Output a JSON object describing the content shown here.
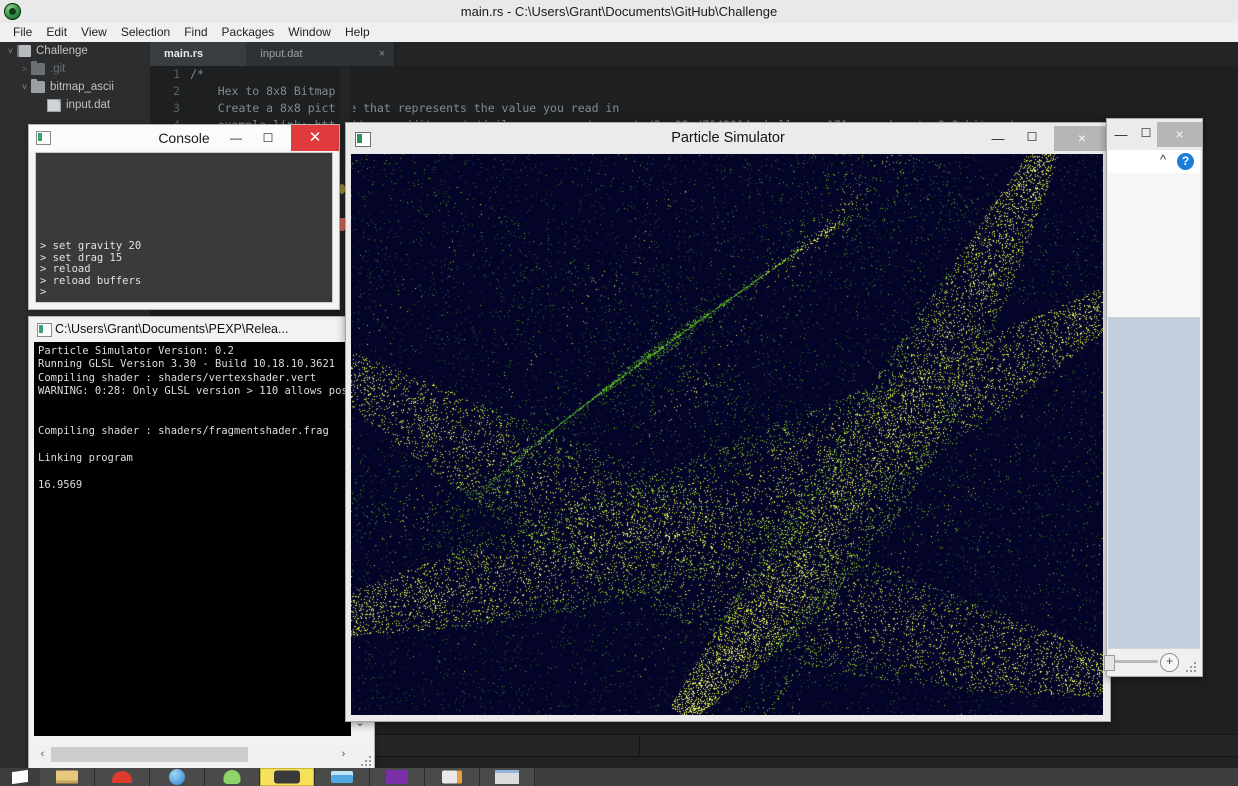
{
  "atom": {
    "title": "main.rs - C:\\Users\\Grant\\Documents\\GitHub\\Challenge",
    "logo_icon": "atom-logo-icon",
    "menu": [
      "File",
      "Edit",
      "View",
      "Selection",
      "Find",
      "Packages",
      "Window",
      "Help"
    ],
    "tree": [
      {
        "label": "Challenge",
        "twisty": "˅",
        "icon": "book-icon",
        "dim": false,
        "indent": 0
      },
      {
        "label": ".git",
        "twisty": "˃",
        "icon": "folder-icon",
        "dim": true,
        "indent": 1
      },
      {
        "label": "bitmap_ascii",
        "twisty": "˅",
        "icon": "folder-icon",
        "dim": false,
        "indent": 1
      },
      {
        "label": "input.dat",
        "twisty": "",
        "icon": "file-icon",
        "dim": false,
        "indent": 2
      }
    ],
    "tabs": [
      {
        "label": "main.rs",
        "active": true,
        "close": "×"
      },
      {
        "label": "input.dat",
        "active": false,
        "close": "×"
      }
    ],
    "code": [
      {
        "num": "1",
        "text": "/*"
      },
      {
        "num": "2",
        "text": "    Hex to 8x8 Bitmap"
      },
      {
        "num": "3",
        "text": "    Create a 8x8 picture that represents the value you read in"
      },
      {
        "num": "4",
        "text": "    example link: http://www.reddit.com/r/dailyprogrammer/comments/2ao99p/7142014_challenge_171_easy_hex_to_8x8_bitmap/"
      }
    ]
  },
  "console_window": {
    "title": "Console",
    "app_icon": "console-app-icon",
    "minimize": "—",
    "maximize": "☐",
    "close": "✕",
    "lines": [
      "> set gravity 20",
      "> set drag 15",
      "> reload",
      "> reload buffers",
      ">"
    ]
  },
  "terminal_window": {
    "title": "C:\\Users\\Grant\\Documents\\PEXP\\Relea...",
    "app_icon": "terminal-app-icon",
    "minimize": "—",
    "lines": [
      "Particle Simulator Version: 0.2",
      "Running GLSL Version 3.30 - Build 10.18.10.3621",
      "Compiling shader : shaders/vertexshader.vert",
      "WARNING: 0:28: Only GLSL version > 110 allows postfi",
      "",
      "",
      "Compiling shader : shaders/fragmentshader.frag",
      "",
      "Linking program",
      "",
      "16.9569"
    ],
    "scroll_down": "⌄",
    "scroll_left": "‹",
    "scroll_right": "›"
  },
  "particle_window": {
    "title": "Particle Simulator",
    "app_icon": "particle-app-icon",
    "minimize": "—",
    "maximize": "☐",
    "close": "×",
    "canvas_bg": "#040428",
    "particle_colors": [
      "#9bdd2c",
      "#e8f540",
      "#5fbf1f",
      "#f6ff6a"
    ]
  },
  "right_window": {
    "minimize": "—",
    "maximize": "☐",
    "close": "×",
    "collapse_ribbon_icon": "chevron-up-icon",
    "help_icon": "question-mark-icon",
    "help_label": "?",
    "zoom_in_label": "+",
    "sheet_color": "#c3cedd"
  },
  "taskbar": [
    {
      "name": "start-button",
      "icon": "windows-logo-icon",
      "color": "#ffffff",
      "highlight": false
    },
    {
      "name": "file-explorer",
      "icon": "folder-icon",
      "color": "#e8c87a",
      "highlight": false
    },
    {
      "name": "app-red",
      "icon": "red-dome-icon",
      "color": "#e03a2f",
      "highlight": false
    },
    {
      "name": "internet-explorer",
      "icon": "globe-icon",
      "color": "#2a7fd4",
      "highlight": false
    },
    {
      "name": "app-green",
      "icon": "green-blob-icon",
      "color": "#8fd36b",
      "highlight": false
    },
    {
      "name": "particle-simulator",
      "icon": "dark-window-icon",
      "color": "#3a3a3a",
      "highlight": true
    },
    {
      "name": "app-blue",
      "icon": "blue-card-icon",
      "color": "#4fa8e0",
      "highlight": false
    },
    {
      "name": "app-purple",
      "icon": "purple-tile-icon",
      "color": "#7b2fa8",
      "highlight": false
    },
    {
      "name": "paint",
      "icon": "paint-brush-icon",
      "color": "#e9e9e9",
      "highlight": false
    },
    {
      "name": "app-window",
      "icon": "window-icon",
      "color": "#dcdcdc",
      "highlight": false
    }
  ]
}
